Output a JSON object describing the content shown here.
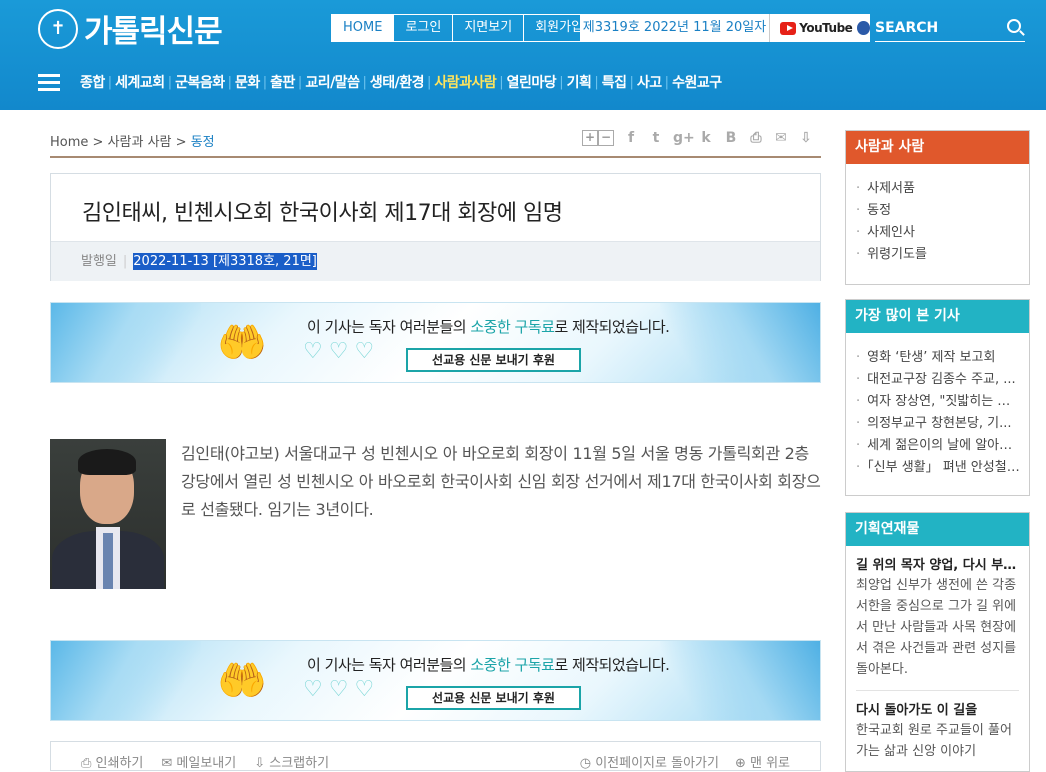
{
  "header": {
    "logo_text": "가톨릭신문",
    "top_nav": [
      "HOME",
      "로그인",
      "지면보기",
      "회원가입"
    ],
    "issue_info": "제3319호 2022년 11월 20일자",
    "youtube_label": "YouTube",
    "search_label": "SEARCH",
    "main_nav": [
      "종합",
      "세계교회",
      "군복음화",
      "문화",
      "출판",
      "교리/말씀",
      "생태/환경",
      "사람과사람",
      "열린마당",
      "기획",
      "특집",
      "사고",
      "수원교구"
    ],
    "active_nav": "사람과사람"
  },
  "breadcrumb": {
    "home": "Home",
    "sep": ">",
    "section": "사람과 사람",
    "current": "동정"
  },
  "tools": {
    "zoom_in": "+",
    "zoom_out": "−",
    "facebook": "f",
    "twitter": "t",
    "googleplus": "g+",
    "kakao": "k",
    "blog": "B",
    "print": "⎙",
    "email": "✉",
    "scrap": "⇩"
  },
  "article": {
    "title": "김인태씨, 빈첸시오회 한국이사회 제17대 회장에 임명",
    "meta_label": "발행일",
    "meta_date": "2022-11-13 [제3318호, 21면]",
    "body": "김인태(야고보) 서울대교구 성 빈첸시오 아 바오로회 회장이 11월 5일 서울 명동 가톨릭회관 2층 강당에서 열린 성 빈첸시오 아 바오로회 한국이사회 신임 회장 선거에서 제17대 한국이사회 회장으로 선출됐다. 임기는 3년이다."
  },
  "banner": {
    "msg_prefix": "이 기사는 독자 여러분들의 ",
    "msg_highlight": "소중한 구독료",
    "msg_suffix": "로 제작되었습니다.",
    "button": "선교용 신문 보내기 후원"
  },
  "bottom_bar": {
    "print": "인쇄하기",
    "email": "메일보내기",
    "scrap": "스크랩하기",
    "back": "이전페이지로 돌아가기",
    "top": "맨 위로"
  },
  "sidebar": {
    "people": {
      "title": "사람과 사람",
      "items": [
        "사제서품",
        "동정",
        "사제인사",
        "위령기도를"
      ]
    },
    "popular": {
      "title": "가장 많이 본 기사",
      "items": [
        "영화 ‘탄생’ 제작 보고회",
        "대전교구장 김종수 주교, ...",
        "여자 장상연, \"짓밟히는 생...",
        "의정부교구 창현본당, 기...",
        "세계 젊은이의 날에 알아보...",
        "「신부 생활」 펴낸 안성철 ..."
      ]
    },
    "series": {
      "title": "기획연재물",
      "items": [
        {
          "title": "길 위의 목자 양업, 다시 부치...",
          "desc": "최양업 신부가 생전에 쓴 각종 서한을 중심으로 그가 길 위에서 만난 사람들과 사목 현장에서 겪은 사건들과 관련 성지를 돌아본다."
        },
        {
          "title": "다시 돌아가도 이 길을",
          "desc": "한국교회 원로 주교들이 풀어가는 삶과 신앙 이야기"
        }
      ]
    }
  }
}
